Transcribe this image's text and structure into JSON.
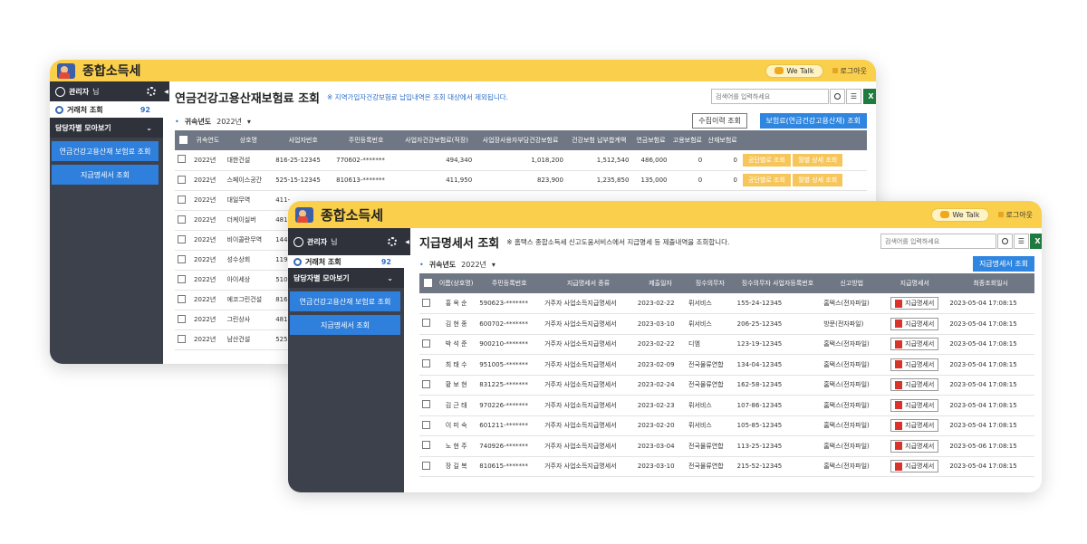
{
  "app": {
    "title": "종합소득세",
    "wetalk": "We Talk",
    "logout": "로그아웃"
  },
  "side": {
    "admin": "관리자",
    "admin_suffix": "님",
    "trade": "거래처 조회",
    "trade_count_back": "92",
    "trade_count_front": "92",
    "section": "담당자별 모아보기",
    "menu1": "연금건강고용산재 보험료 조회",
    "menu2": "지급명세서 조회"
  },
  "back": {
    "title": "연금건강고용산재보험료 조회",
    "note": "※ 지역가입자건강보험료 납입내역은 조회 대상에서 제외됩니다.",
    "search_placeholder": "검색어를 입력하세요",
    "filter_label": "귀속년도",
    "filter_value": "2022년",
    "btn_history": "수집이력 조회",
    "btn_query": "보험료(연금건강고용산재) 조회",
    "columns": [
      "귀속연도",
      "상호명",
      "사업자번호",
      "주민등록번호",
      "사업자건강보험료(직장)",
      "사업장사용자부담건강보험료",
      "건강보험 납부합계액",
      "연금보험료",
      "고용보험료",
      "산재보험료"
    ],
    "row_btn1": "공단별로 조회",
    "row_btn2": "월별 상세 조회",
    "rows": [
      [
        "2022년",
        "대한건설",
        "816-25-12345",
        "770602-*******",
        "494,340",
        "1,018,200",
        "1,512,540",
        "486,000",
        "0",
        "0"
      ],
      [
        "2022년",
        "스페이스공간",
        "525-15-12345",
        "810613-*******",
        "411,950",
        "823,900",
        "1,235,850",
        "135,000",
        "0",
        "0"
      ],
      [
        "2022년",
        "대일무역",
        "411-",
        "",
        "",
        "",
        "",
        "",
        "",
        ""
      ],
      [
        "2022년",
        "더케이실버",
        "481-",
        "",
        "",
        "",
        "",
        "",
        "",
        ""
      ],
      [
        "2022년",
        "비이콜란무역",
        "144-",
        "",
        "",
        "",
        "",
        "",
        "",
        ""
      ],
      [
        "2022년",
        "성수상회",
        "119",
        "",
        "",
        "",
        "",
        "",
        "",
        ""
      ],
      [
        "2022년",
        "아이세상",
        "510",
        "",
        "",
        "",
        "",
        "",
        "",
        ""
      ],
      [
        "2022년",
        "에코그린건설",
        "816-",
        "",
        "",
        "",
        "",
        "",
        "",
        ""
      ],
      [
        "2022년",
        "그린상사",
        "481-",
        "",
        "",
        "",
        "",
        "",
        "",
        ""
      ],
      [
        "2022년",
        "남산건설",
        "525",
        "",
        "",
        "",
        "",
        "",
        "",
        ""
      ]
    ]
  },
  "front": {
    "title": "지급명세서 조회",
    "note": "※ 홈택스 종합소득세 신고도움서비스에서 지급명세 등 제출내역을 조회합니다.",
    "search_placeholder": "검색어를 입력하세요",
    "filter_label": "귀속년도",
    "filter_value": "2022년",
    "btn_query": "지급명세서 조회",
    "columns": [
      "이름(상호명)",
      "주민등록번호",
      "지급명세서 종류",
      "제출일자",
      "징수의무자",
      "징수의무자 사업자등록번호",
      "신고방법",
      "지급명세서",
      "최종조회일시"
    ],
    "pdf_label": "지급명세서",
    "rows": [
      [
        "홍 옥 순",
        "590623-*******",
        "거주자 사업소득지급명세서",
        "2023-02-22",
        "뤼서비스",
        "155-24-12345",
        "홈택스(전자파일)",
        "2023-05-04 17:08:15"
      ],
      [
        "김 현 종",
        "600702-*******",
        "거주자 사업소득지급명세서",
        "2023-03-10",
        "뤼서비스",
        "206-25-12345",
        "방문(전자파일)",
        "2023-05-04 17:08:15"
      ],
      [
        "박 석 준",
        "900210-*******",
        "거주자 사업소득지급명세서",
        "2023-02-22",
        "디엠",
        "123-19-12345",
        "홈택스(전자파일)",
        "2023-05-04 17:08:15"
      ],
      [
        "최 태 수",
        "951005-*******",
        "거주자 사업소득지급명세서",
        "2023-02-09",
        "전국물류연합",
        "134-04-12345",
        "홈택스(전자파일)",
        "2023-05-04 17:08:15"
      ],
      [
        "황 보 현",
        "831225-*******",
        "거주자 사업소득지급명세서",
        "2023-02-24",
        "전국물류연합",
        "162-58-12345",
        "홈택스(전자파일)",
        "2023-05-04 17:08:15"
      ],
      [
        "김 근 태",
        "970226-*******",
        "거주자 사업소득지급명세서",
        "2023-02-23",
        "뤼서비스",
        "107-86-12345",
        "홈택스(전자파일)",
        "2023-05-04 17:08:15"
      ],
      [
        "이 미 숙",
        "601211-*******",
        "거주자 사업소득지급명세서",
        "2023-02-20",
        "뤼서비스",
        "105-85-12345",
        "홈택스(전자파일)",
        "2023-05-04 17:08:15"
      ],
      [
        "노 현 주",
        "740926-*******",
        "거주자 사업소득지급명세서",
        "2023-03-04",
        "전국물류연합",
        "113-25-12345",
        "홈택스(전자파일)",
        "2023-05-06 17:08:15"
      ],
      [
        "장 길 복",
        "810615-*******",
        "거주자 사업소득지급명세서",
        "2023-03-10",
        "전국물류연합",
        "215-52-12345",
        "홈택스(전자파일)",
        "2023-05-04 17:08:15"
      ]
    ]
  }
}
